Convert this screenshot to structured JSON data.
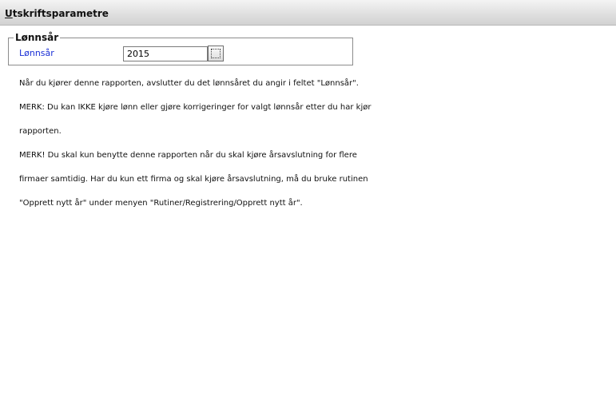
{
  "header": {
    "title_mnemonic": "U",
    "title_rest": "tskriftsparametre"
  },
  "group": {
    "legend": "Lønnsår",
    "field_label": "Lønnsår",
    "year_value": "2015"
  },
  "info_lines": [
    "Når du kjører denne rapporten, avslutter du det lønnsåret du angir i feltet \"Lønnsår\".",
    "MERK: Du kan IKKE kjøre lønn eller gjøre korrigeringer for valgt lønnsår etter du har kjør",
    "rapporten.",
    "MERK! Du skal kun benytte denne rapporten når du skal kjøre årsavslutning for flere",
    "firmaer samtidig. Har du kun ett firma og skal kjøre årsavslutning, må du bruke rutinen",
    "\"Opprett nytt år\" under menyen \"Rutiner/Registrering/Opprett nytt år\"."
  ]
}
